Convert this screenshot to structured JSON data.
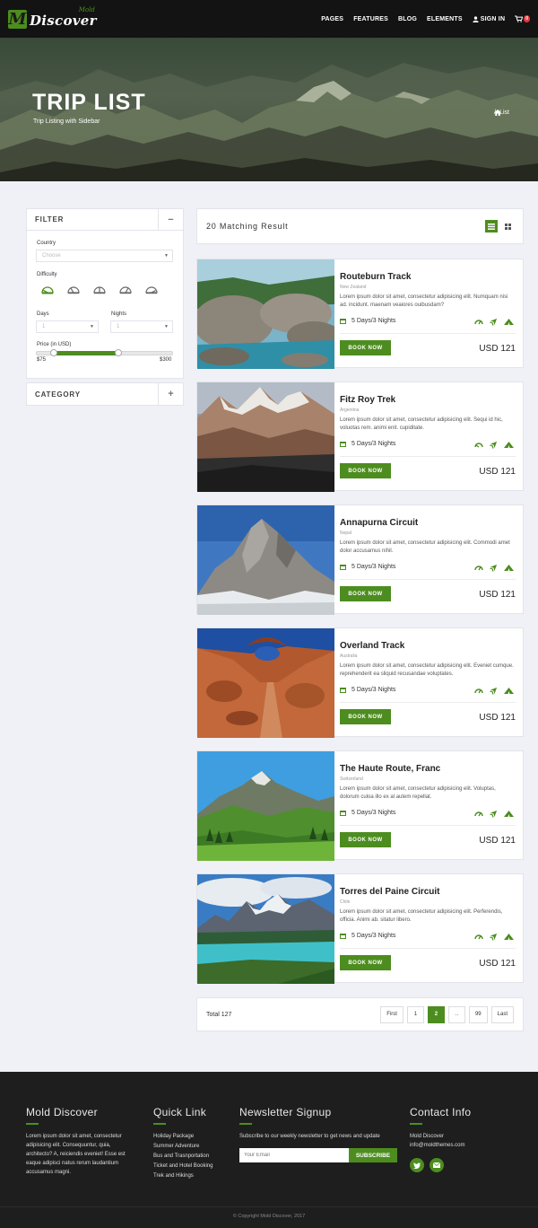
{
  "brand": {
    "small": "Mold",
    "big": "Discover",
    "mark": "M",
    "accent": "#4d8d1f"
  },
  "nav": {
    "items": [
      "PAGES",
      "FEATURES",
      "BLOG",
      "ELEMENTS"
    ],
    "signin": "SIGN IN",
    "cart_count": "0",
    "icons": {
      "signin": "user-icon",
      "cart": "cart-icon"
    }
  },
  "hero": {
    "title": "TRIP LIST",
    "subtitle": "Trip Listing with Sidebar",
    "breadcrumb": {
      "current": "List",
      "separator": "/"
    }
  },
  "filter": {
    "title": "FILTER",
    "toggle": "−",
    "country_label": "Country",
    "country_value": "Choose",
    "difficulty_label": "Difficulty",
    "days_label": "Days",
    "days_value": "1",
    "nights_label": "Nights",
    "nights_value": "1",
    "price_label": "Price (in USD)",
    "price_min": "$75",
    "price_max": "$300",
    "range_low_fraction": 0.13,
    "range_high_fraction": 0.6
  },
  "category": {
    "title": "CATEGORY",
    "toggle": "+"
  },
  "results": {
    "count_text": "20 Matching Result",
    "view_icons": [
      "list-view-icon",
      "grid-view-icon"
    ]
  },
  "trips": [
    {
      "name": "Routeburn Track",
      "country": "New Zealand",
      "desc": "Lorem ipsum dolor sit amet, consectetur adipisicing elit. Numquam nisi ad. incidunt. maenam veaiores ouibusdam?",
      "duration": "5 Days/3 Nights",
      "book": "BOOK NOW",
      "price": "USD 121"
    },
    {
      "name": "Fitz Roy Trek",
      "country": "Argentina",
      "desc": "Lorem ipsum dolor sit amet, consectetur adipisicing elit. Sequi id hic, voluotas rem. animi enit. cupiditate.",
      "duration": "5 Days/3 Nights",
      "book": "BOOK NOW",
      "price": "USD 121"
    },
    {
      "name": "Annapurna Circuit",
      "country": "Nepal",
      "desc": "Lorem ipsum dolor sit amet, consectetur adipisicing elit. Commodi amet dolor accusamus nihil.",
      "duration": "5 Days/3 Nights",
      "book": "BOOK NOW",
      "price": "USD 121"
    },
    {
      "name": "Overland Track",
      "country": "Australia",
      "desc": "Lorem ipsum dolor sit amet, consectetur adipisicing elit. Eveniet cumque. reprehenderit ea sliquid recusandae voluptates.",
      "duration": "5 Days/3 Nights",
      "book": "BOOK NOW",
      "price": "USD 121"
    },
    {
      "name": "The Haute Route, Franc",
      "country": "Switzerland",
      "desc": "Lorem ipsum dolor sit amet, consectetur adipisicing elit. Voluptas, dolorum culoa illo ex al autem repellat.",
      "duration": "5 Days/3 Nights",
      "book": "BOOK NOW",
      "price": "USD 121"
    },
    {
      "name": "Torres del Paine Circuit",
      "country": "Chile",
      "desc": "Lorem ipsum dolor sit amet, consectetur adipisicing elit. Perferendis, officia. Animi ab. sitatur libero.",
      "duration": "5 Days/3 Nights",
      "book": "BOOK NOW",
      "price": "USD 121"
    }
  ],
  "pagination": {
    "total": "Total 127",
    "first": "First",
    "p1": "1",
    "p2": "2",
    "ellipsis": "..",
    "p99": "99",
    "last": "Last"
  },
  "footer": {
    "about": {
      "title": "Mold Discover",
      "text": "Lorem ipsum dolor sit amet, consectetur adipisicing elit. Consequuntur, quia, architecto? A, reiciendis eveniet! Esse est eaque adipisci natus rerum laudantium accusamus magni."
    },
    "quick": {
      "title": "Quick Link",
      "links": [
        "Holiday Package",
        "Summer Adventure",
        "Bus and Trasnportation",
        "Ticket and Hotel Booking",
        "Trek and Hikings"
      ]
    },
    "newsletter": {
      "title": "Newsletter Signup",
      "text": "Subscribe to our weekly newsletter to get news and update",
      "placeholder": "Your Email",
      "button": "SUBSCRIBE"
    },
    "contact": {
      "title": "Contact Info",
      "name": "Mold Discover",
      "email": "info@moldthemes.com",
      "social": [
        "twitter-icon",
        "email-icon"
      ]
    },
    "copyright": "Copyright Mold Discover, 2017"
  }
}
